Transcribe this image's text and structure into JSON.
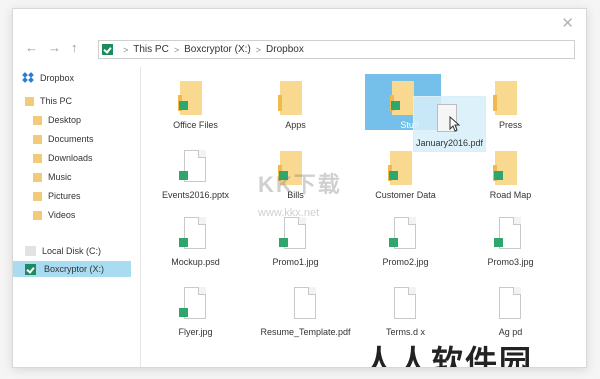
{
  "window": {
    "close_icon": "✕"
  },
  "nav": {
    "back_icon": "←",
    "forward_icon": "→",
    "up_icon": "↑"
  },
  "address": {
    "crumbs": [
      "This PC",
      "Boxcryptor (X:)",
      "Dropbox"
    ],
    "separator": ">"
  },
  "sidebar": {
    "items": [
      {
        "label": "Dropbox",
        "icon": "dropbox-icon"
      },
      {
        "label": "This PC",
        "icon": "folder-icon"
      },
      {
        "label": "Desktop",
        "icon": "folder-icon"
      },
      {
        "label": "Documents",
        "icon": "folder-icon"
      },
      {
        "label": "Downloads",
        "icon": "folder-icon"
      },
      {
        "label": "Music",
        "icon": "folder-icon"
      },
      {
        "label": "Pictures",
        "icon": "folder-icon"
      },
      {
        "label": "Videos",
        "icon": "folder-icon"
      },
      {
        "label": "Local Disk (C:)",
        "icon": "drive-icon"
      },
      {
        "label": "Boxcryptor (X:)",
        "icon": "boxcryptor-icon",
        "selected": true
      }
    ]
  },
  "files": [
    {
      "label": "Office Files",
      "type": "folder",
      "badge": true
    },
    {
      "label": "Apps",
      "type": "folder",
      "badge": false
    },
    {
      "label": "Stuff",
      "type": "folder",
      "badge": true,
      "selected": true
    },
    {
      "label": "Press",
      "type": "folder",
      "badge": false
    },
    {
      "label": "Events2016.pptx",
      "type": "file",
      "badge": true
    },
    {
      "label": "Bills",
      "type": "folder",
      "badge": true
    },
    {
      "label": "Customer Data",
      "type": "folder",
      "badge": true
    },
    {
      "label": "Road Map",
      "type": "folder",
      "badge": true
    },
    {
      "label": "Mockup.psd",
      "type": "file",
      "badge": true
    },
    {
      "label": "Promo1.jpg",
      "type": "file",
      "badge": true
    },
    {
      "label": "Promo2.jpg",
      "type": "file",
      "badge": true
    },
    {
      "label": "Promo3.jpg",
      "type": "file",
      "badge": true
    },
    {
      "label": "Flyer.jpg",
      "type": "file",
      "badge": true
    },
    {
      "label": "Resume_Template.pdf",
      "type": "file",
      "badge": false
    },
    {
      "label": "Terms.d  x",
      "type": "file",
      "badge": false
    },
    {
      "label": "Ag      pd",
      "type": "file",
      "badge": false
    }
  ],
  "drag": {
    "label": "January2016.pdf"
  },
  "watermark": {
    "text": "KK下载",
    "url": "www.kkx.net",
    "bottom": "人人软件园"
  },
  "colors": {
    "accent": "#2fa66b",
    "selected": "#a9dcf1",
    "folder": "#f9d88f",
    "highlight": "#74c0ea"
  }
}
